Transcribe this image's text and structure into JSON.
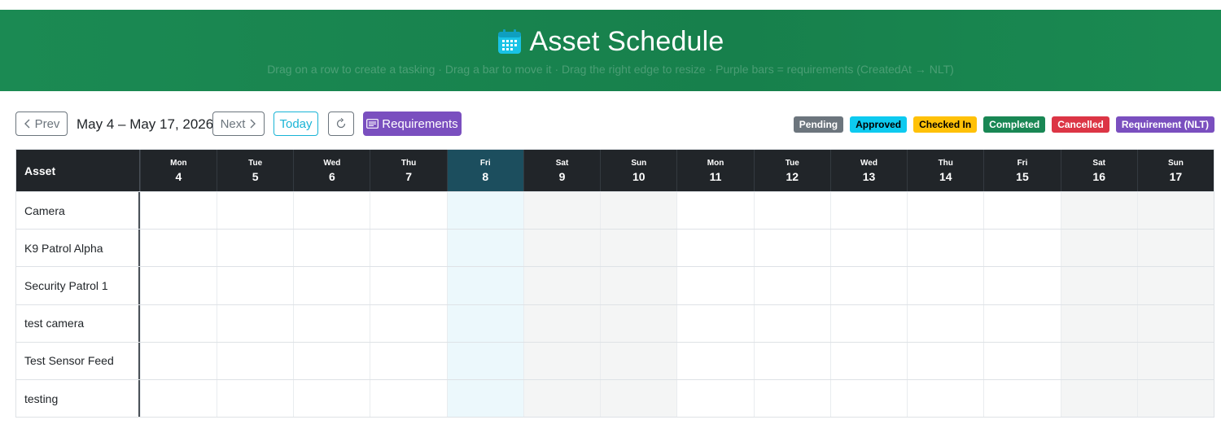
{
  "header": {
    "title": "Asset Schedule",
    "hint": "Drag on a row to create a tasking  ·  Drag a bar to move it  ·  Drag the right edge to resize  ·  Purple bars = requirements (CreatedAt → NLT)"
  },
  "toolbar": {
    "prev_label": "Prev",
    "next_label": "Next",
    "today_label": "Today",
    "requirements_label": "Requirements",
    "range_label": "May 4 – May 17, 2026"
  },
  "legend": [
    {
      "label": "Pending",
      "color": "#6c757d",
      "text": "#ffffff"
    },
    {
      "label": "Approved",
      "color": "#0dcaf0",
      "text": "#000000"
    },
    {
      "label": "Checked In",
      "color": "#ffc107",
      "text": "#000000"
    },
    {
      "label": "Completed",
      "color": "#198754",
      "text": "#ffffff"
    },
    {
      "label": "Cancelled",
      "color": "#dc3545",
      "text": "#ffffff"
    },
    {
      "label": "Requirement (NLT)",
      "color": "#7a4fbf",
      "text": "#ffffff"
    }
  ],
  "schedule": {
    "asset_header": "Asset",
    "days": [
      {
        "dow": "Mon",
        "num": "4"
      },
      {
        "dow": "Tue",
        "num": "5"
      },
      {
        "dow": "Wed",
        "num": "6"
      },
      {
        "dow": "Thu",
        "num": "7"
      },
      {
        "dow": "Fri",
        "num": "8",
        "today": true
      },
      {
        "dow": "Sat",
        "num": "9",
        "weekend": true
      },
      {
        "dow": "Sun",
        "num": "10",
        "weekend": true
      },
      {
        "dow": "Mon",
        "num": "11"
      },
      {
        "dow": "Tue",
        "num": "12"
      },
      {
        "dow": "Wed",
        "num": "13"
      },
      {
        "dow": "Thu",
        "num": "14"
      },
      {
        "dow": "Fri",
        "num": "15"
      },
      {
        "dow": "Sat",
        "num": "16",
        "weekend": true
      },
      {
        "dow": "Sun",
        "num": "17",
        "weekend": true
      }
    ],
    "assets": [
      "Camera",
      "K9 Patrol Alpha",
      "Security Patrol 1",
      "test camera",
      "Test Sensor Feed",
      "testing"
    ]
  },
  "colors": {
    "banner": "#1b8a53",
    "today_header": "#1c4e5e",
    "today_cell": "#ecf8fc",
    "weekend_cell": "#f4f5f5",
    "accent_purple": "#7a4fbf",
    "accent_cyan": "#19b4d6"
  }
}
